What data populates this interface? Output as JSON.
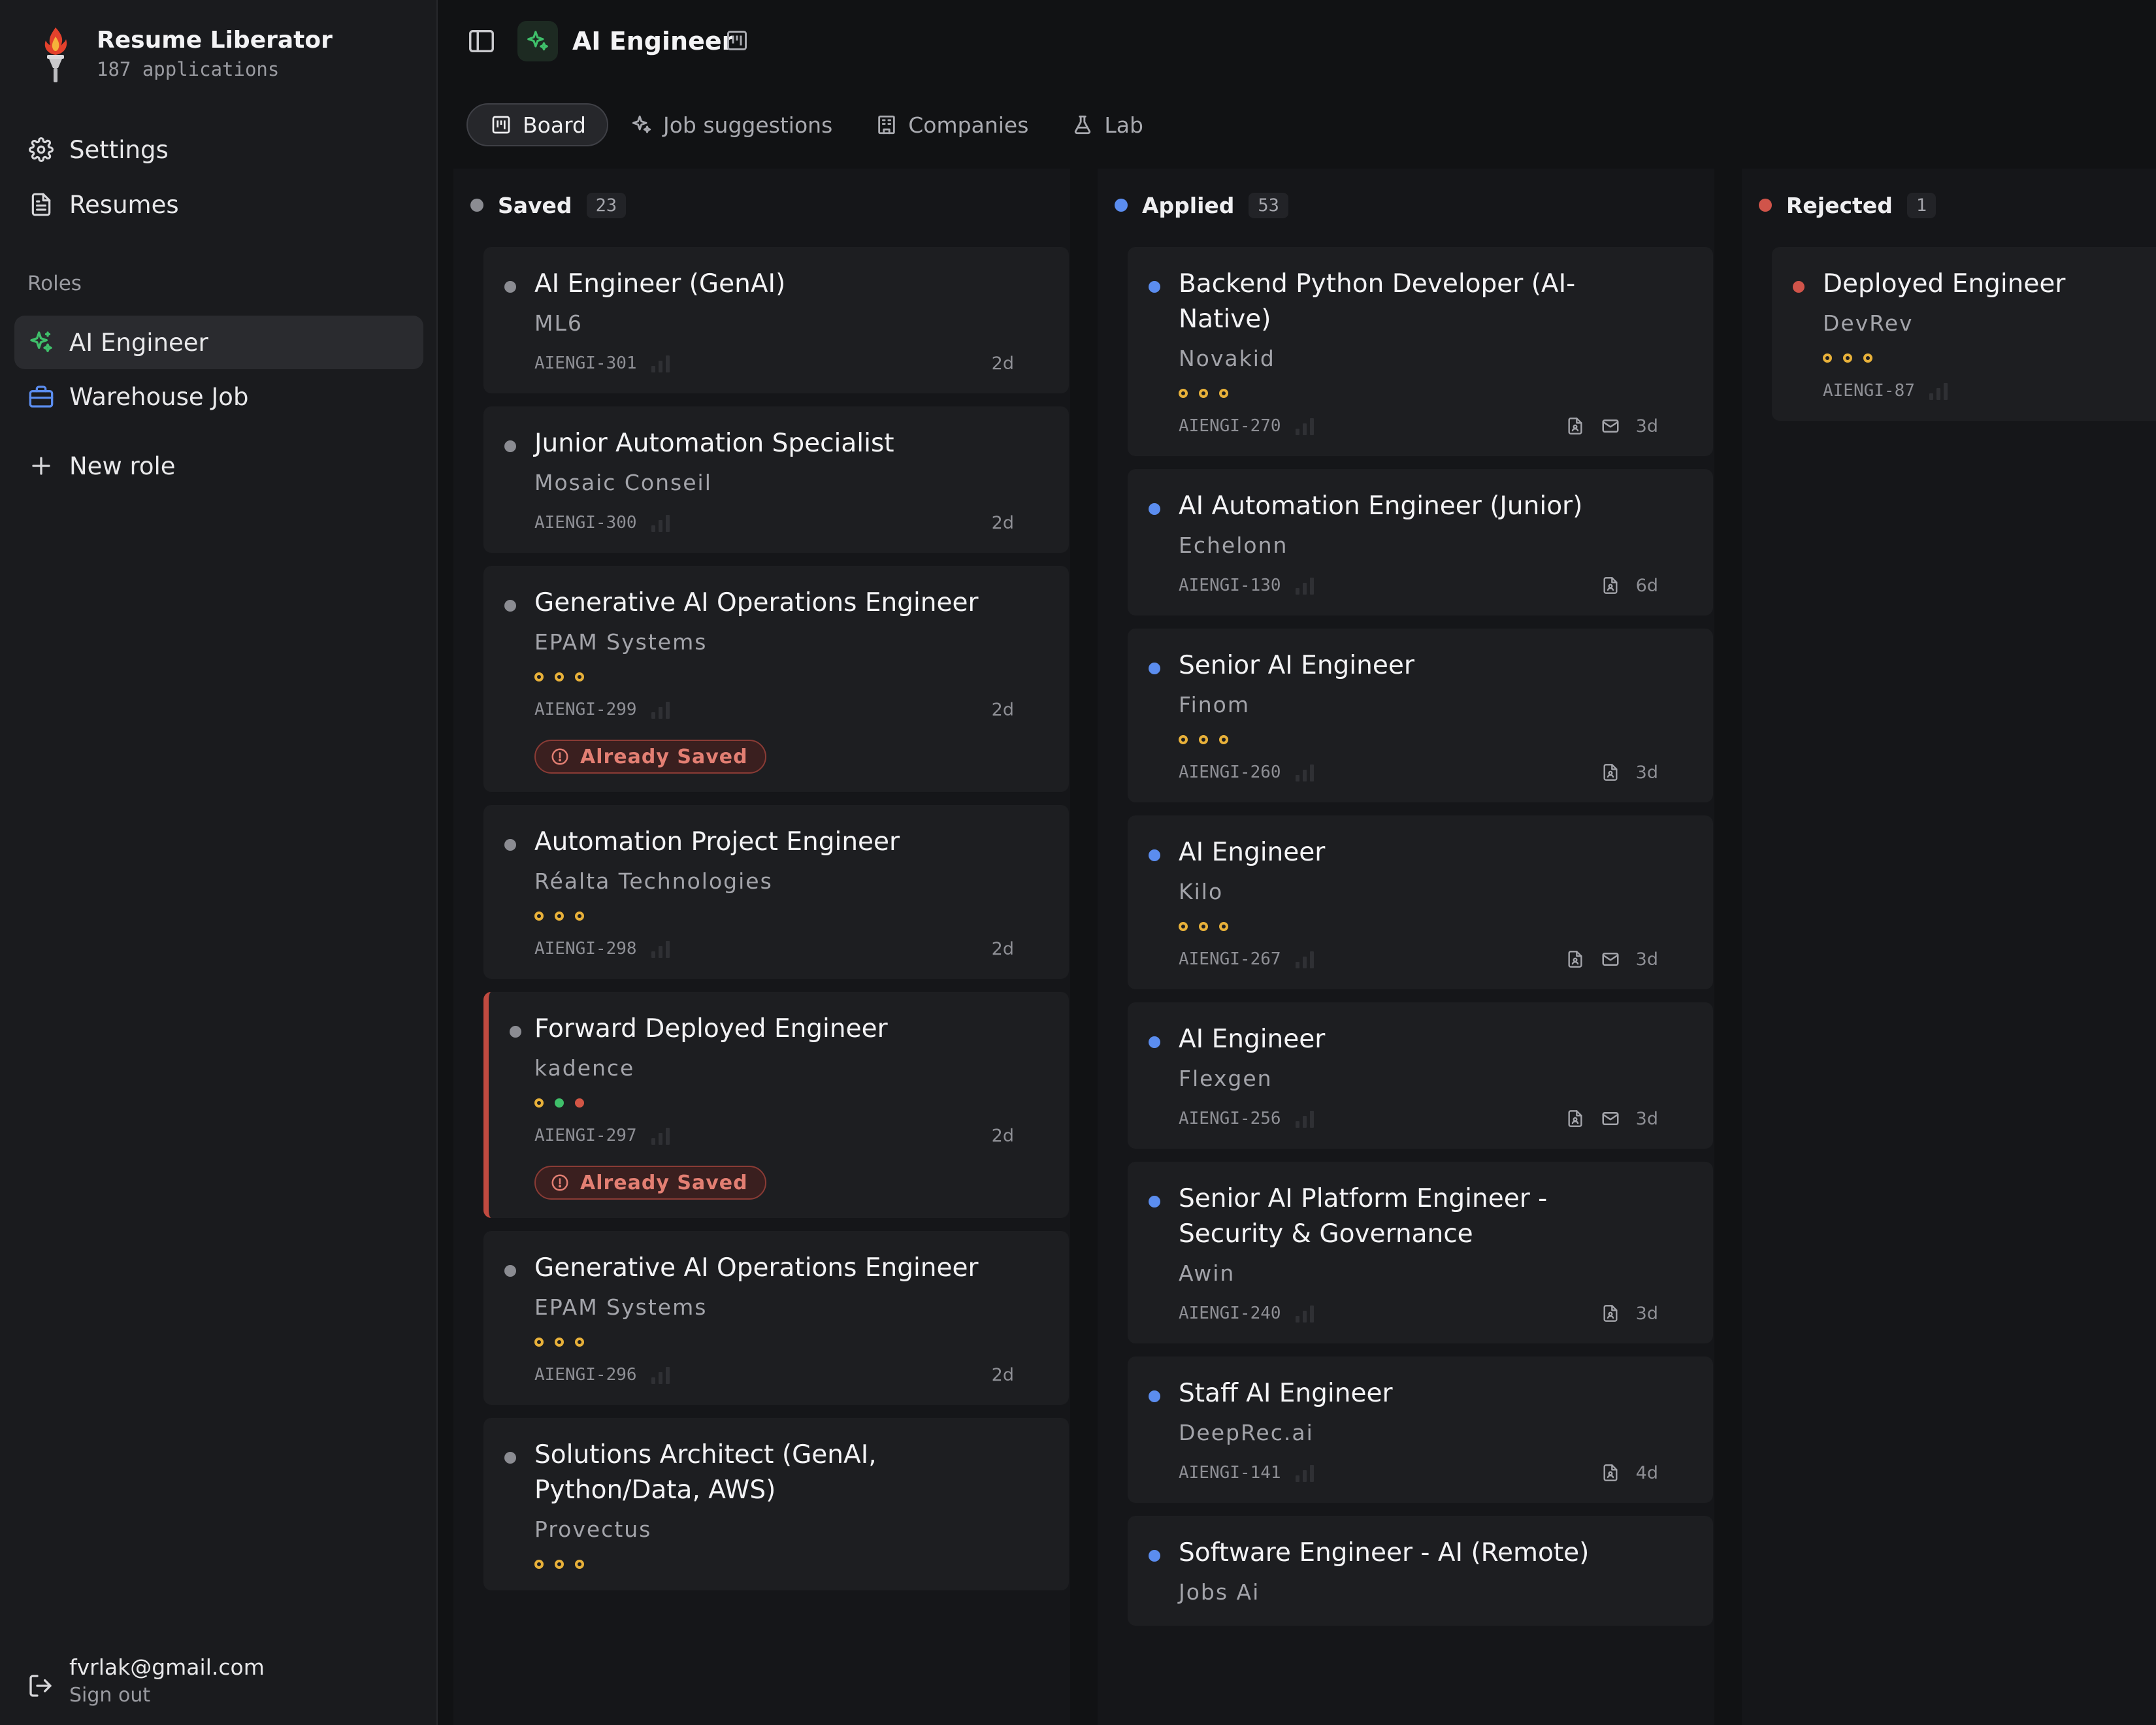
{
  "app": {
    "name": "Resume Liberator",
    "subtitle": "187 applications"
  },
  "sidebar": {
    "nav": [
      {
        "label": "Settings",
        "icon": "gear-icon"
      },
      {
        "label": "Resumes",
        "icon": "document-icon"
      }
    ],
    "roles_label": "Roles",
    "roles": [
      {
        "label": "AI Engineer",
        "icon": "sparkle-icon",
        "active": true
      },
      {
        "label": "Warehouse Job",
        "icon": "briefcase-icon",
        "active": false
      }
    ],
    "new_role_label": "New role",
    "user": {
      "email": "fvrlak@gmail.com",
      "sign_out": "Sign out"
    }
  },
  "header": {
    "title": "AI Engineer"
  },
  "tabs": [
    {
      "label": "Board",
      "icon": "board-icon",
      "active": true
    },
    {
      "label": "Job suggestions",
      "icon": "sparkles-icon",
      "active": false
    },
    {
      "label": "Companies",
      "icon": "building-icon",
      "active": false
    },
    {
      "label": "Lab",
      "icon": "flask-icon",
      "active": false
    }
  ],
  "colors": {
    "saved": "#8b8c92",
    "applied": "#5b8def",
    "rejected": "#d0544a",
    "accent_green": "#3fbf6a",
    "warning_amber": "#e8b13a"
  },
  "columns": [
    {
      "key": "saved",
      "name": "Saved",
      "count": "23",
      "cards": [
        {
          "title": "AI Engineer (GenAI)",
          "company": "ML6",
          "dots": [],
          "id": "AIENGI-301",
          "age": "2d",
          "icons": [],
          "badge": "",
          "flagged": false
        },
        {
          "title": "Junior Automation Specialist",
          "company": "Mosaic Conseil",
          "dots": [],
          "id": "AIENGI-300",
          "age": "2d",
          "icons": [],
          "badge": "",
          "flagged": false
        },
        {
          "title": "Generative AI Operations Engineer",
          "company": "EPAM Systems",
          "dots": [
            "o",
            "o",
            "o"
          ],
          "id": "AIENGI-299",
          "age": "2d",
          "icons": [],
          "badge": "Already Saved",
          "flagged": false
        },
        {
          "title": "Automation Project Engineer",
          "company": "Réalta Technologies",
          "dots": [
            "o",
            "o",
            "o"
          ],
          "id": "AIENGI-298",
          "age": "2d",
          "icons": [],
          "badge": "",
          "flagged": false
        },
        {
          "title": "Forward Deployed Engineer",
          "company": "kadence",
          "dots": [
            "o",
            "g",
            "r"
          ],
          "id": "AIENGI-297",
          "age": "2d",
          "icons": [],
          "badge": "Already Saved",
          "flagged": true
        },
        {
          "title": "Generative AI Operations Engineer",
          "company": "EPAM Systems",
          "dots": [
            "o",
            "o",
            "o"
          ],
          "id": "AIENGI-296",
          "age": "2d",
          "icons": [],
          "badge": "",
          "flagged": false
        },
        {
          "title": "Solutions Architect (GenAI, Python/Data, AWS)",
          "company": "Provectus",
          "dots": [
            "o",
            "o",
            "o"
          ],
          "id": "",
          "age": "",
          "icons": [],
          "badge": "",
          "flagged": false
        }
      ]
    },
    {
      "key": "applied",
      "name": "Applied",
      "count": "53",
      "cards": [
        {
          "title": "Backend Python Developer (AI-Native)",
          "company": "Novakid",
          "dots": [
            "o",
            "o",
            "o"
          ],
          "id": "AIENGI-270",
          "age": "3d",
          "icons": [
            "resume-file-icon",
            "mail-icon"
          ],
          "badge": "",
          "flagged": false
        },
        {
          "title": "AI Automation Engineer (Junior)",
          "company": "Echelonn",
          "dots": [],
          "id": "AIENGI-130",
          "age": "6d",
          "icons": [
            "resume-file-icon"
          ],
          "badge": "",
          "flagged": false
        },
        {
          "title": "Senior AI Engineer",
          "company": "Finom",
          "dots": [
            "o",
            "o",
            "o"
          ],
          "id": "AIENGI-260",
          "age": "3d",
          "icons": [
            "resume-file-icon"
          ],
          "badge": "",
          "flagged": false
        },
        {
          "title": "AI Engineer",
          "company": "Kilo",
          "dots": [
            "o",
            "o",
            "o"
          ],
          "id": "AIENGI-267",
          "age": "3d",
          "icons": [
            "resume-file-icon",
            "mail-icon"
          ],
          "badge": "",
          "flagged": false
        },
        {
          "title": "AI Engineer",
          "company": "Flexgen",
          "dots": [],
          "id": "AIENGI-256",
          "age": "3d",
          "icons": [
            "resume-file-icon",
            "mail-icon"
          ],
          "badge": "",
          "flagged": false
        },
        {
          "title": "Senior AI Platform Engineer - Security & Governance",
          "company": "Awin",
          "dots": [],
          "id": "AIENGI-240",
          "age": "3d",
          "icons": [
            "resume-file-icon"
          ],
          "badge": "",
          "flagged": false
        },
        {
          "title": "Staff AI Engineer",
          "company": "DeepRec.ai",
          "dots": [],
          "id": "AIENGI-141",
          "age": "4d",
          "icons": [
            "resume-file-icon"
          ],
          "badge": "",
          "flagged": false
        },
        {
          "title": "Software Engineer - AI (Remote)",
          "company": "Jobs Ai",
          "dots": [],
          "id": "",
          "age": "",
          "icons": [],
          "badge": "",
          "flagged": false
        }
      ]
    },
    {
      "key": "rejected",
      "name": "Rejected",
      "count": "1",
      "cards": [
        {
          "title": "Deployed Engineer",
          "company": "DevRev",
          "dots": [
            "o",
            "o",
            "o"
          ],
          "id": "AIENGI-87",
          "age": "",
          "icons": [],
          "badge": "",
          "flagged": false
        }
      ]
    }
  ]
}
